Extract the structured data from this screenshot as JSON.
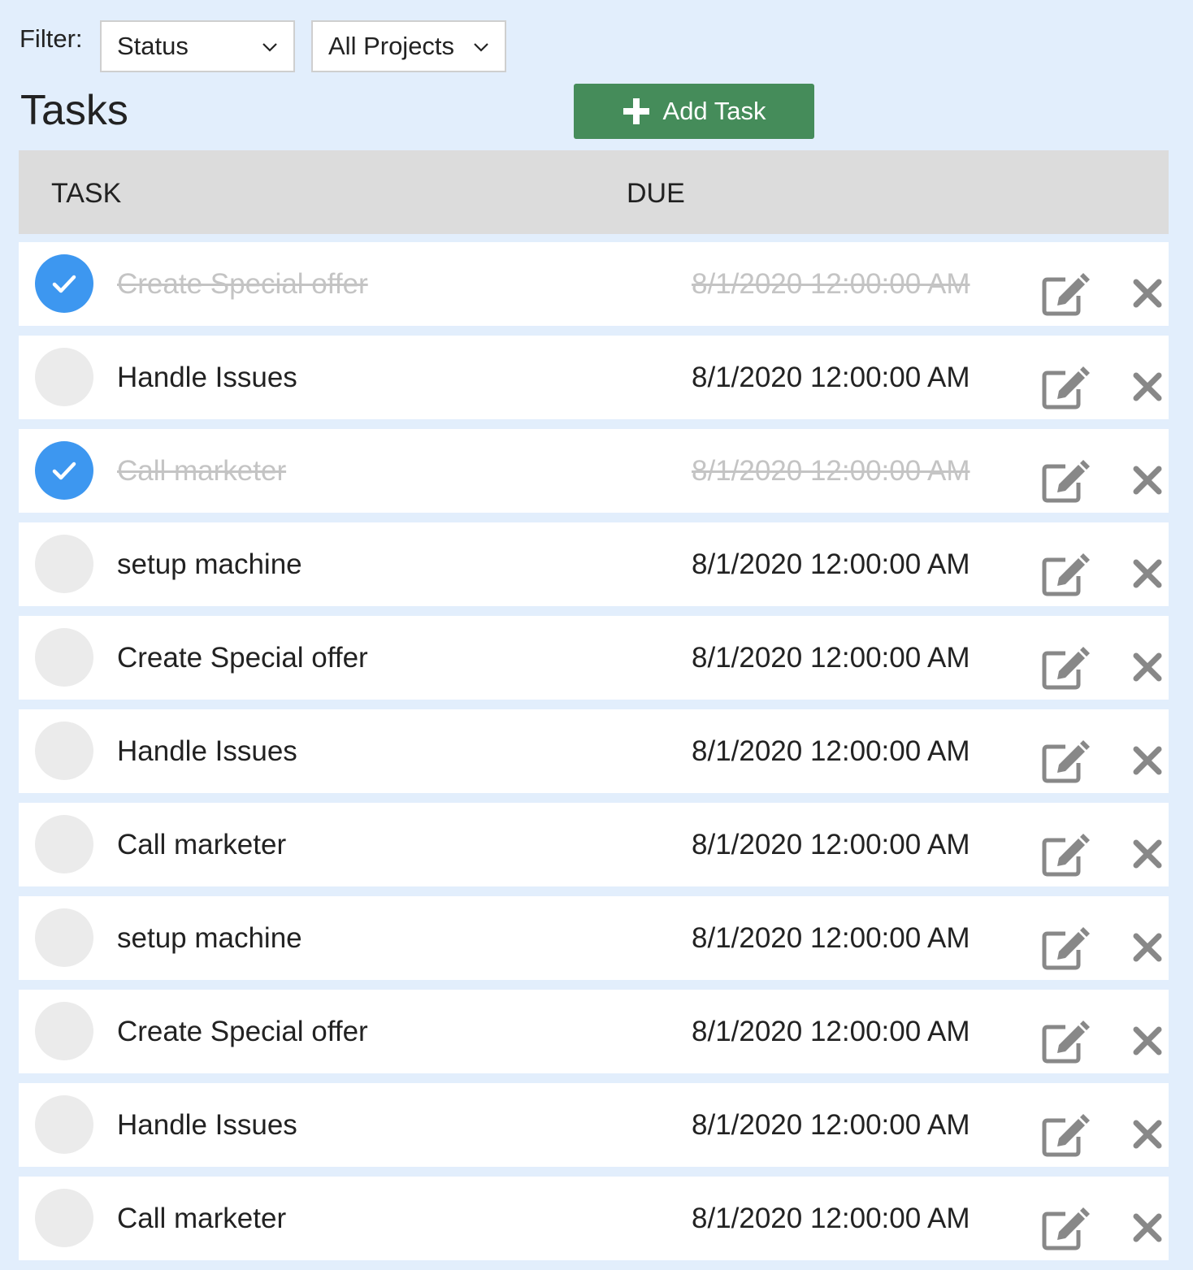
{
  "filter": {
    "label": "Filter:",
    "status_value": "Status",
    "project_value": "All Projects"
  },
  "page": {
    "title": "Tasks",
    "add_button_label": "Add Task"
  },
  "table": {
    "headers": {
      "task": "TASK",
      "due": "DUE"
    },
    "rows": [
      {
        "name": "Create Special offer",
        "due": "8/1/2020 12:00:00 AM",
        "completed": true
      },
      {
        "name": "Handle Issues",
        "due": "8/1/2020 12:00:00 AM",
        "completed": false
      },
      {
        "name": "Call marketer",
        "due": "8/1/2020 12:00:00 AM",
        "completed": true
      },
      {
        "name": "setup machine",
        "due": "8/1/2020 12:00:00 AM",
        "completed": false
      },
      {
        "name": "Create Special offer",
        "due": "8/1/2020 12:00:00 AM",
        "completed": false
      },
      {
        "name": "Handle Issues",
        "due": "8/1/2020 12:00:00 AM",
        "completed": false
      },
      {
        "name": "Call marketer",
        "due": "8/1/2020 12:00:00 AM",
        "completed": false
      },
      {
        "name": "setup machine",
        "due": "8/1/2020 12:00:00 AM",
        "completed": false
      },
      {
        "name": "Create Special offer",
        "due": "8/1/2020 12:00:00 AM",
        "completed": false
      },
      {
        "name": "Handle Issues",
        "due": "8/1/2020 12:00:00 AM",
        "completed": false
      },
      {
        "name": "Call marketer",
        "due": "8/1/2020 12:00:00 AM",
        "completed": false
      }
    ]
  },
  "colors": {
    "background": "#e2eefc",
    "accent_green": "#458c5a",
    "check_blue": "#3d97f0",
    "icon_gray": "#888888"
  },
  "icons": {
    "check": "checkmark-icon",
    "edit": "edit-icon",
    "delete": "close-icon",
    "add": "plus-icon",
    "dropdown": "chevron-down-icon"
  }
}
